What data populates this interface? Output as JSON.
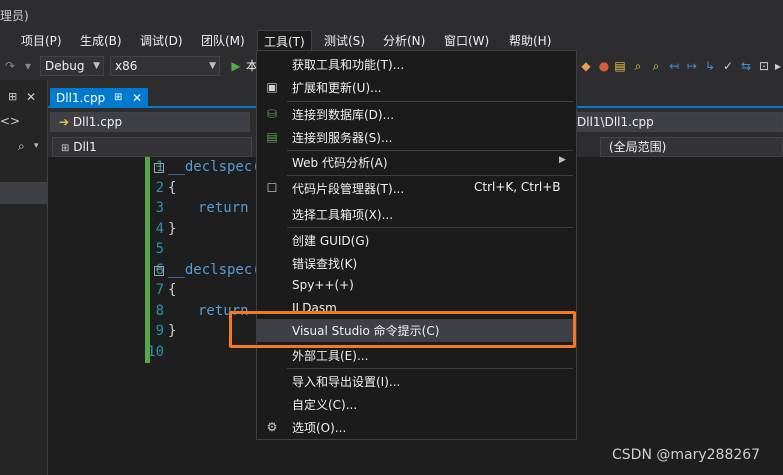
{
  "window": {
    "title_fragment": "理员)"
  },
  "menubar": {
    "items": [
      "项目(P)",
      "生成(B)",
      "调试(D)",
      "团队(M)",
      "工具(T)",
      "测试(S)",
      "分析(N)",
      "窗口(W)",
      "帮助(H)"
    ]
  },
  "toolbar": {
    "config": "Debug",
    "platform": "x86",
    "run_label_fragment": "本"
  },
  "tabs": {
    "active_tab": "Dll1.cpp",
    "pin_glyph": "⊞",
    "close_glyph": "✕"
  },
  "nav": {
    "file": "Dll1.cpp",
    "path_fragment": "Dll1\\Dll1.cpp",
    "project": "Dll1",
    "scope": "(全局范围)"
  },
  "editor": {
    "line_numbers": [
      "1",
      "2",
      "3",
      "4",
      "5",
      "6",
      "7",
      "8",
      "9",
      "10"
    ],
    "code": {
      "decl1": "__declspec(d",
      "brace_open1": "{",
      "return1": "return",
      "brace_close1": "}",
      "decl2": "__declspec(d",
      "brace_open2": "{",
      "return2": "return",
      "brace_close2": "}"
    }
  },
  "tools_menu": {
    "items": [
      {
        "label": "获取工具和功能(T)..."
      },
      {
        "label": "扩展和更新(U)..."
      },
      {
        "label": "连接到数据库(D)..."
      },
      {
        "label": "连接到服务器(S)..."
      },
      {
        "label": "Web 代码分析(A)",
        "submenu": "▶"
      },
      {
        "label": "代码片段管理器(T)...",
        "shortcut": "Ctrl+K, Ctrl+B"
      },
      {
        "label": "选择工具箱项(X)..."
      },
      {
        "label": "创建 GUID(G)"
      },
      {
        "label": "错误查找(K)"
      },
      {
        "label": "Spy++(+)"
      },
      {
        "label": "ILDasm"
      },
      {
        "label": "Visual Studio 命令提示(C)"
      },
      {
        "label": "外部工具(E)..."
      },
      {
        "label": "导入和导出设置(I)..."
      },
      {
        "label": "自定义(C)..."
      },
      {
        "label": "选项(O)..."
      }
    ]
  },
  "colors": {
    "highlight_box": "#f47920",
    "accent": "#007acc"
  },
  "watermark": "CSDN @mary288267"
}
